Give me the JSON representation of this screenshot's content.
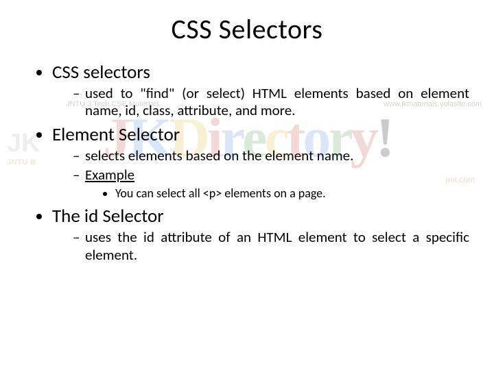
{
  "title": "CSS Selectors",
  "bullets": {
    "b1": {
      "label": "CSS selectors",
      "sub": {
        "s1": "used to \"find\" (or select) HTML elements based on element name, id, class, attribute, and more."
      }
    },
    "b2": {
      "label": "Element Selector",
      "sub": {
        "s1": "selects elements based on the element name.",
        "s2": "Example",
        "s2_sub": {
          "t1": "You can select all <p> elements on a page."
        }
      }
    },
    "b3": {
      "label": "The id Selector",
      "sub": {
        "s1": "uses the id attribute of an HTML element to select a specific element."
      }
    }
  },
  "watermark": {
    "strip_left": "JNTU 3 Tech CSE Materials",
    "strip_right": "www.jkmaterials.yolasite.com",
    "jk_top": "JK",
    "jk_bottom": "JNTU B",
    "logo_chars": [
      "J",
      "K",
      "D",
      "i",
      "r",
      "e",
      "c",
      "t",
      "o",
      "r",
      "y",
      "!"
    ],
    "sub": "pot.com"
  }
}
